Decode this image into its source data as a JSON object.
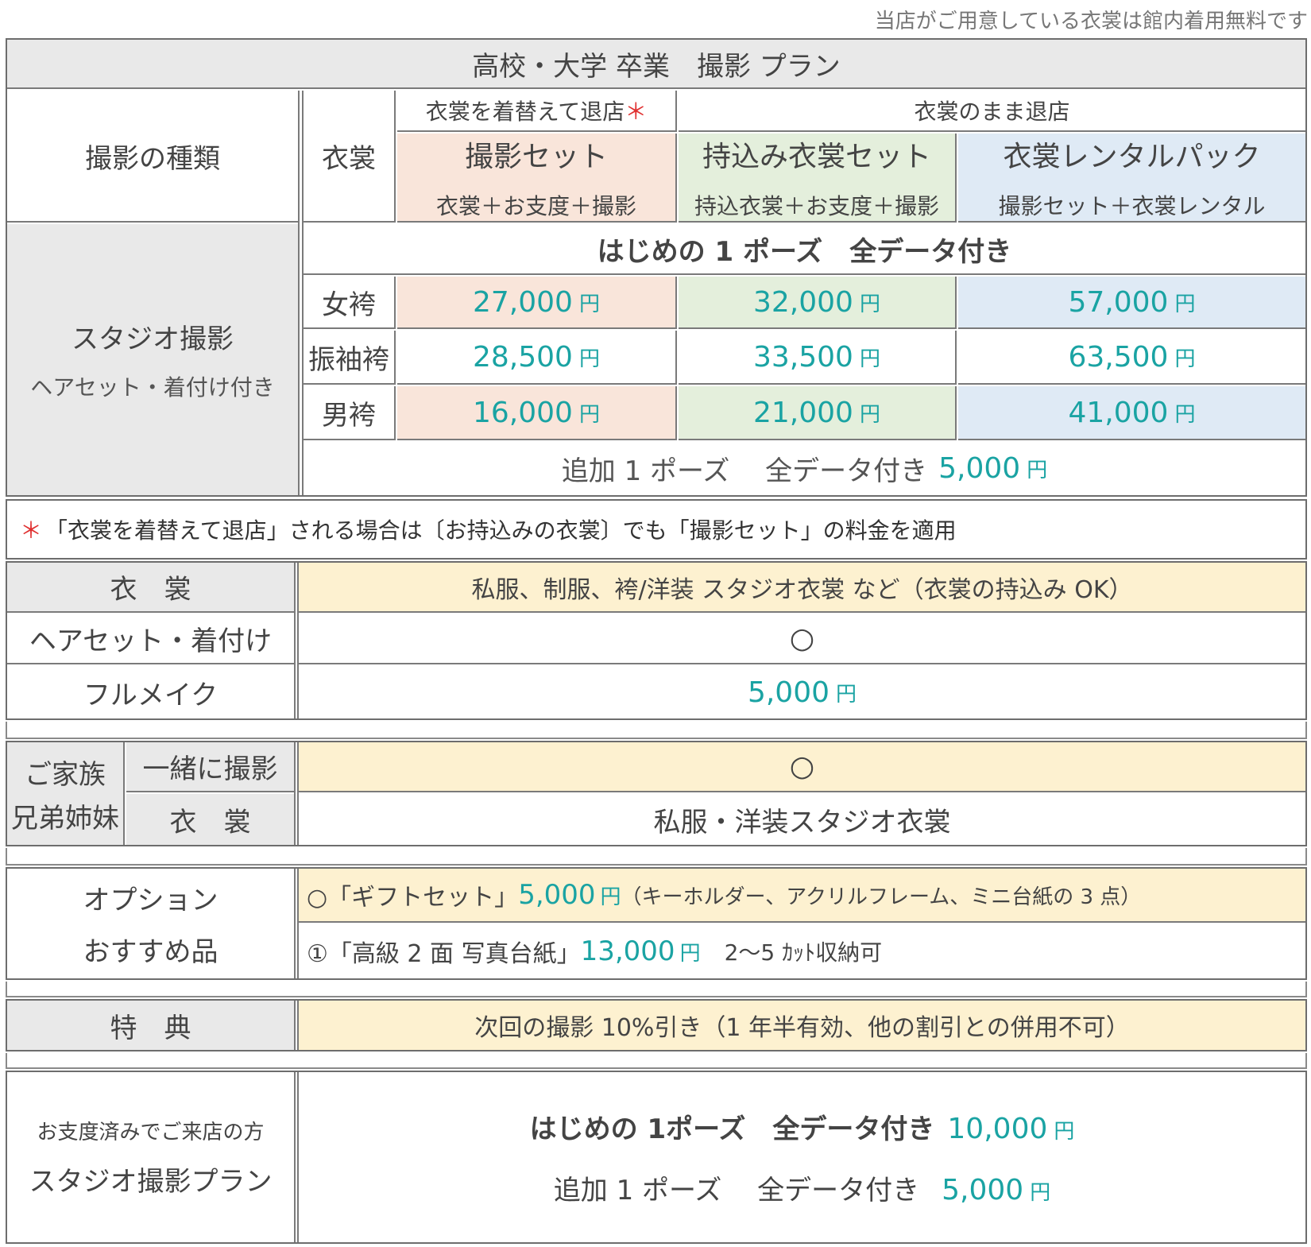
{
  "top_note": "当店がご用意している衣裳は館内着用無料です",
  "title": "高校・大学 卒業　撮影 プラン",
  "plan": {
    "type_label": "撮影の種類",
    "costume_label": "衣裳",
    "group_change": "衣裳を着替えて退店",
    "group_change_mark": "＊",
    "group_keep": "衣裳のまま退店",
    "plans": [
      {
        "name": "撮影セット",
        "desc": "衣裳＋お支度＋撮影"
      },
      {
        "name": "持込み衣裳セット",
        "desc": "持込衣裳＋お支度＋撮影"
      },
      {
        "name": "衣裳レンタルパック",
        "desc": "撮影セット＋衣裳レンタル"
      }
    ],
    "studio_title": "スタジオ撮影",
    "studio_sub": "ヘアセット・着付け付き",
    "first_pose": "はじめの 1 ポーズ　全データ付き",
    "rows": [
      {
        "label": "女袴",
        "prices": [
          "27,000",
          "32,000",
          "57,000"
        ]
      },
      {
        "label": "振袖袴",
        "prices": [
          "28,500",
          "33,500",
          "63,500"
        ]
      },
      {
        "label": "男袴",
        "prices": [
          "16,000",
          "21,000",
          "41,000"
        ]
      }
    ],
    "yen": "円",
    "extra_pose": "追加 1 ポーズ　 全データ付き",
    "extra_price": "5,000"
  },
  "note": {
    "mark": "＊",
    "text": "「衣裳を着替えて退店」される場合は〔お持込みの衣裳〕でも「撮影セット」の料金を適用"
  },
  "details": {
    "costume_label": "衣　裳",
    "costume_value": "私服、制服、袴/洋装 スタジオ衣裳 など（衣裳の持込み OK）",
    "hair_label": "ヘアセット・着付け",
    "hair_value": "○",
    "makeup_label": "フルメイク",
    "makeup_price": "5,000"
  },
  "family": {
    "label_1": "ご家族",
    "label_2": "兄弟姉妹",
    "together_label": "一緒に撮影",
    "together_value": "○",
    "costume_label": "衣　裳",
    "costume_value": "私服・洋装スタジオ衣裳"
  },
  "options": {
    "label_1": "オプション",
    "label_2": "おすすめ品",
    "gift_prefix": "○「ギフトセット」",
    "gift_price": "5,000",
    "gift_suffix": "（キーホルダー、アクリルフレーム、ミニ台紙の 3 点）",
    "mount_prefix": "①「高級 2 面 写真台紙」",
    "mount_price": "13,000",
    "mount_suffix": "2〜5 ｶｯﾄ収納可"
  },
  "benefit": {
    "label": "特　典",
    "value": "次回の撮影 10%引き（1 年半有効、他の割引との併用不可）"
  },
  "ready": {
    "label_1": "お支度済みでご来店の方",
    "label_2": "スタジオ撮影プラン",
    "line1_text": "はじめの 1ポーズ　全データ付き",
    "line1_price": "10,000",
    "line2_text": "追加 1 ポーズ　 全データ付き",
    "line2_price": "5,000"
  }
}
